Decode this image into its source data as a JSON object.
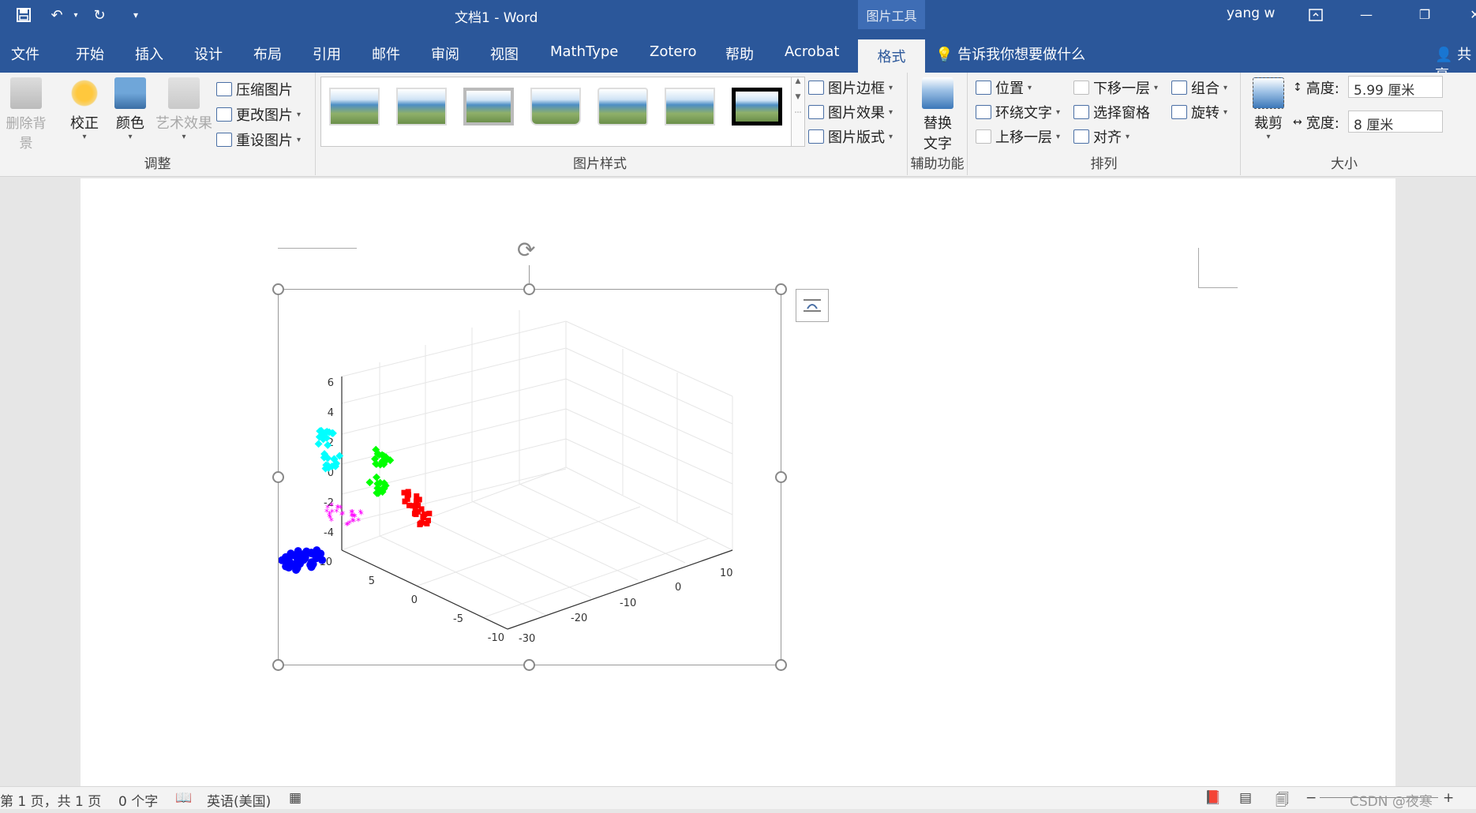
{
  "titlebar": {
    "doc_title": "文档1  -  Word",
    "context_tool": "图片工具",
    "user": "yang w"
  },
  "tabs": [
    "文件",
    "开始",
    "插入",
    "设计",
    "布局",
    "引用",
    "邮件",
    "审阅",
    "视图",
    "MathType",
    "Zotero",
    "帮助",
    "Acrobat",
    "格式"
  ],
  "active_tab": "格式",
  "tellme": "告诉我你想要做什么",
  "share": "共享",
  "ribbon": {
    "adjust": {
      "label": "调整",
      "remove_bg": "删除背景",
      "correct": "校正",
      "color": "颜色",
      "art": "艺术效果",
      "compress": "压缩图片",
      "change": "更改图片",
      "reset": "重设图片"
    },
    "styles": {
      "label": "图片样式",
      "border": "图片边框",
      "effects": "图片效果",
      "layout": "图片版式"
    },
    "access": {
      "label": "辅助功能",
      "alt_line1": "替换",
      "alt_line2": "文字"
    },
    "arrange": {
      "label": "排列",
      "position": "位置",
      "wrap": "环绕文字",
      "forward": "上移一层",
      "backward": "下移一层",
      "pane": "选择窗格",
      "align": "对齐",
      "group": "组合",
      "rotate": "旋转"
    },
    "size": {
      "label": "大小",
      "crop": "裁剪",
      "height_label": "高度:",
      "height_value": "5.99 厘米",
      "width_label": "宽度:",
      "width_value": "8 厘米"
    }
  },
  "status": {
    "page": "第 1 页，共 1 页",
    "words": "0 个字",
    "lang": "英语(美国)",
    "watermark": "CSDN @夜寒"
  },
  "chart_data": {
    "type": "scatter",
    "z_ticks": [
      "6",
      "4",
      "2",
      "0",
      "-2",
      "-4"
    ],
    "x_ticks": [
      "10",
      "5",
      "0",
      "-5",
      "-10"
    ],
    "y_ticks": [
      "-30",
      "-20",
      "-10",
      "0",
      "10"
    ],
    "series": [
      {
        "color": "#0000ff",
        "marker": "circle",
        "points": [
          [
            0,
            -22,
            -3
          ],
          [
            1,
            -21,
            -3.3
          ],
          [
            -1,
            -23,
            -2.8
          ]
        ]
      },
      {
        "color": "#00ffff",
        "marker": "triangle",
        "points": [
          [
            -8,
            -5,
            3.5
          ],
          [
            -8,
            -6,
            5
          ]
        ]
      },
      {
        "color": "#00ff00",
        "marker": "diamond",
        "points": [
          [
            -8,
            4,
            2.5
          ],
          [
            -8,
            3,
            0.8
          ]
        ]
      },
      {
        "color": "#ff00ff",
        "marker": "star",
        "points": [
          [
            -6,
            -8,
            -0.5
          ],
          [
            -5,
            -6,
            -1.5
          ]
        ]
      },
      {
        "color": "#ff0000",
        "marker": "square",
        "points": [
          [
            -6,
            6,
            -1
          ],
          [
            -6,
            8,
            -2.5
          ]
        ]
      }
    ]
  }
}
